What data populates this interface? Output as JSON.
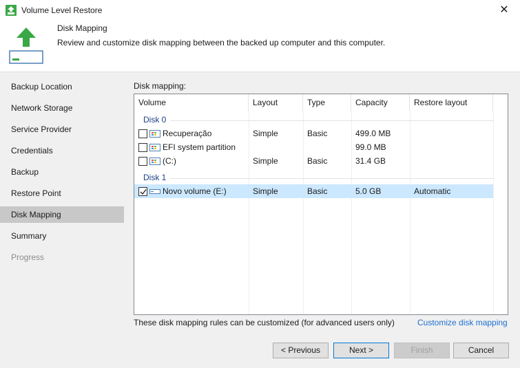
{
  "window": {
    "title": "Volume Level Restore",
    "close_glyph": "✕"
  },
  "header": {
    "title": "Disk Mapping",
    "description": "Review and customize disk mapping between the backed up computer and this computer."
  },
  "sidebar": {
    "items": [
      {
        "label": "Backup Location",
        "state": "normal"
      },
      {
        "label": "Network Storage",
        "state": "normal"
      },
      {
        "label": "Service Provider",
        "state": "normal"
      },
      {
        "label": "Credentials",
        "state": "normal"
      },
      {
        "label": "Backup",
        "state": "normal"
      },
      {
        "label": "Restore Point",
        "state": "normal"
      },
      {
        "label": "Disk Mapping",
        "state": "active"
      },
      {
        "label": "Summary",
        "state": "normal"
      },
      {
        "label": "Progress",
        "state": "disabled"
      }
    ]
  },
  "main": {
    "section_label": "Disk mapping:",
    "columns": [
      "Volume",
      "Layout",
      "Type",
      "Capacity",
      "Restore layout"
    ],
    "groups": [
      {
        "label": "Disk 0",
        "rows": [
          {
            "volume": "Recuperação",
            "layout": "Simple",
            "type": "Basic",
            "capacity": "499.0 MB",
            "restore_layout": "",
            "checked": false,
            "icon": "partition-icon"
          },
          {
            "volume": "EFI system partition",
            "layout": "",
            "type": "",
            "capacity": "99.0 MB",
            "restore_layout": "",
            "checked": false,
            "icon": "partition-icon"
          },
          {
            "volume": "(C:)",
            "layout": "Simple",
            "type": "Basic",
            "capacity": "31.4 GB",
            "restore_layout": "",
            "checked": false,
            "icon": "partition-icon"
          }
        ]
      },
      {
        "label": "Disk 1",
        "rows": [
          {
            "volume": "Novo volume (E:)",
            "layout": "Simple",
            "type": "Basic",
            "capacity": "5.0 GB",
            "restore_layout": "Automatic",
            "checked": true,
            "icon": "drive-icon"
          }
        ]
      }
    ],
    "footer_note": "These disk mapping rules can be customized (for advanced users only)",
    "customize_link": "Customize disk mapping"
  },
  "buttons": {
    "previous": "< Previous",
    "next": "Next >",
    "finish": "Finish",
    "cancel": "Cancel"
  },
  "colors": {
    "accent": "#0078d7",
    "brand_green": "#3aa845",
    "selection": "#cce8ff",
    "link": "#1e6fd1"
  }
}
